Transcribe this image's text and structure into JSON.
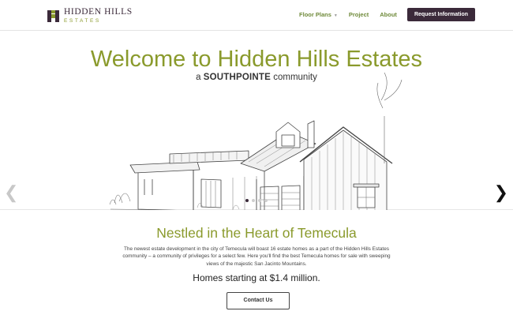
{
  "brand": {
    "title": "HIDDEN HILLS",
    "subtitle": "ESTATES"
  },
  "nav": {
    "floor_plans": "Floor Plans",
    "project": "Project",
    "about": "About",
    "cta": "Request Information"
  },
  "hero": {
    "title": "Welcome to Hidden Hills Estates",
    "sub_prefix": "a",
    "sub_brand": "SOUTHPOINTE",
    "sub_suffix": "community",
    "prev_arrow": "❮",
    "next_arrow": "❯",
    "slide_count": 4,
    "active_slide": 1
  },
  "section": {
    "title": "Nestled in the Heart of Temecula",
    "body": "The newest estate development in the city of Temecula will boast 16 estate homes as a part of the Hidden Hills Estates community – a community of privileges for a select few. Here you'll find the best Temecula homes for sale with sweeping views of the majestic San Jacinto Mountains.",
    "price": "Homes starting at $1.4 million.",
    "contact": "Contact Us"
  },
  "colors": {
    "accent_green": "#8a9a2c",
    "brand_plum": "#3b2a3a"
  }
}
